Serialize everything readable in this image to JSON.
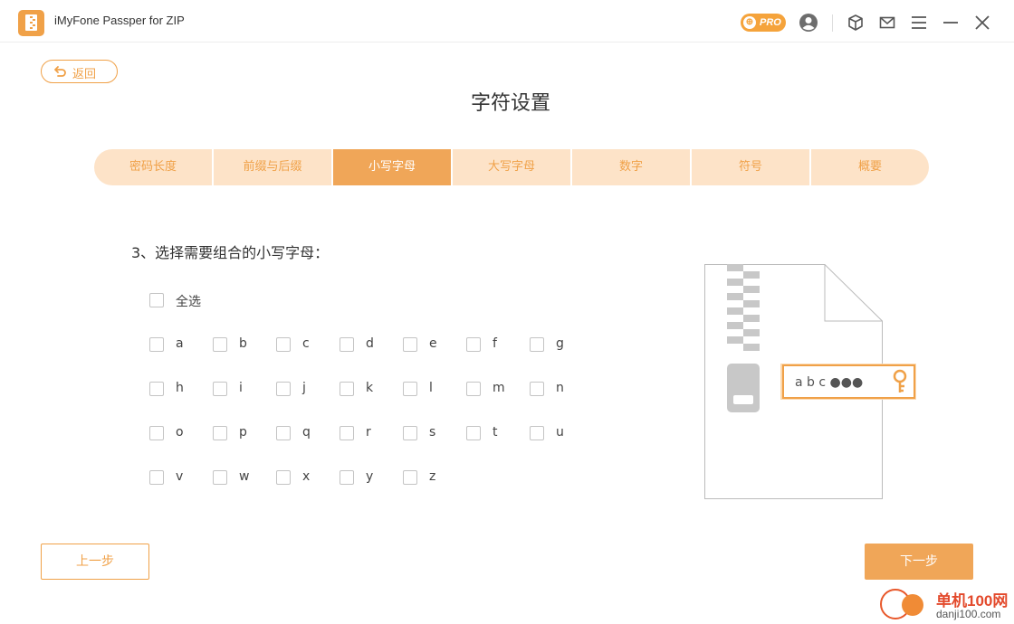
{
  "app": {
    "title": "iMyFone Passper for ZIP",
    "pro_label": "PRO"
  },
  "nav": {
    "back_label": "返回"
  },
  "page": {
    "title": "字符设置"
  },
  "steps": [
    {
      "label": "密码长度",
      "active": false
    },
    {
      "label": "前缀与后缀",
      "active": false
    },
    {
      "label": "小写字母",
      "active": true
    },
    {
      "label": "大写字母",
      "active": false
    },
    {
      "label": "数字",
      "active": false
    },
    {
      "label": "符号",
      "active": false
    },
    {
      "label": "概要",
      "active": false
    }
  ],
  "section": {
    "label": "3、选择需要组合的小写字母："
  },
  "select_all": {
    "label": "全选",
    "checked": false
  },
  "letters": [
    "a",
    "b",
    "c",
    "d",
    "e",
    "f",
    "g",
    "h",
    "i",
    "j",
    "k",
    "l",
    "m",
    "n",
    "o",
    "p",
    "q",
    "r",
    "s",
    "t",
    "u",
    "v",
    "w",
    "x",
    "y",
    "z"
  ],
  "illustration": {
    "password_text": "a b c ●●●"
  },
  "footer": {
    "prev_label": "上一步",
    "next_label": "下一步"
  },
  "watermark": {
    "title": "单机100网",
    "url": "danji100.com"
  },
  "colors": {
    "accent": "#f0a148",
    "tab_bg": "#fde3c8",
    "tab_active": "#f0a658"
  },
  "icons": [
    "zip-app-icon",
    "pro-badge-icon",
    "user-icon",
    "box-icon",
    "mail-icon",
    "menu-icon",
    "minimize-icon",
    "close-icon",
    "back-arrow-icon",
    "key-icon"
  ]
}
